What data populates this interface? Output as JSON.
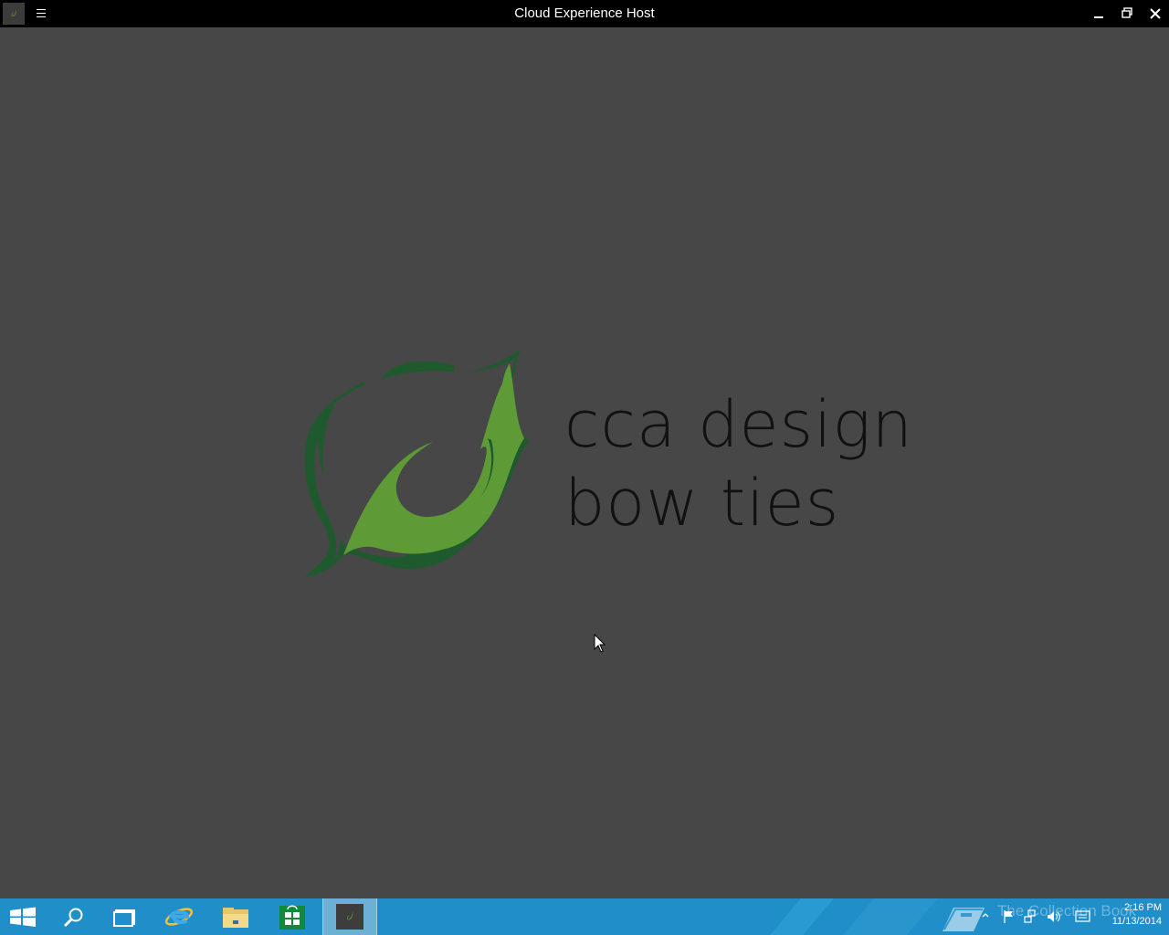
{
  "window": {
    "title": "Cloud Experience Host",
    "icons": [
      "app-leaf-icon",
      "hamburger-menu-icon",
      "minimize-icon",
      "restore-icon",
      "close-icon"
    ]
  },
  "splash": {
    "brand_line1": "cca design",
    "brand_line2": "bow ties",
    "leaf_colors": {
      "dark": "#1f5a2e",
      "light": "#5e9a36"
    },
    "background": "#474747"
  },
  "taskbar": {
    "background": "#1f8ec9",
    "items": [
      "start-icon",
      "search-icon",
      "task-view-icon",
      "internet-explorer-icon",
      "file-explorer-icon",
      "store-icon",
      "cloud-experience-host-icon"
    ],
    "watermark": "The Collection Book",
    "tray_icons": [
      "show-hidden-icons-chevron",
      "action-center-flag-icon",
      "network-icon",
      "volume-icon",
      "notifications-icon"
    ],
    "clock_time": "2:16 PM",
    "clock_date": "11/13/2014"
  }
}
